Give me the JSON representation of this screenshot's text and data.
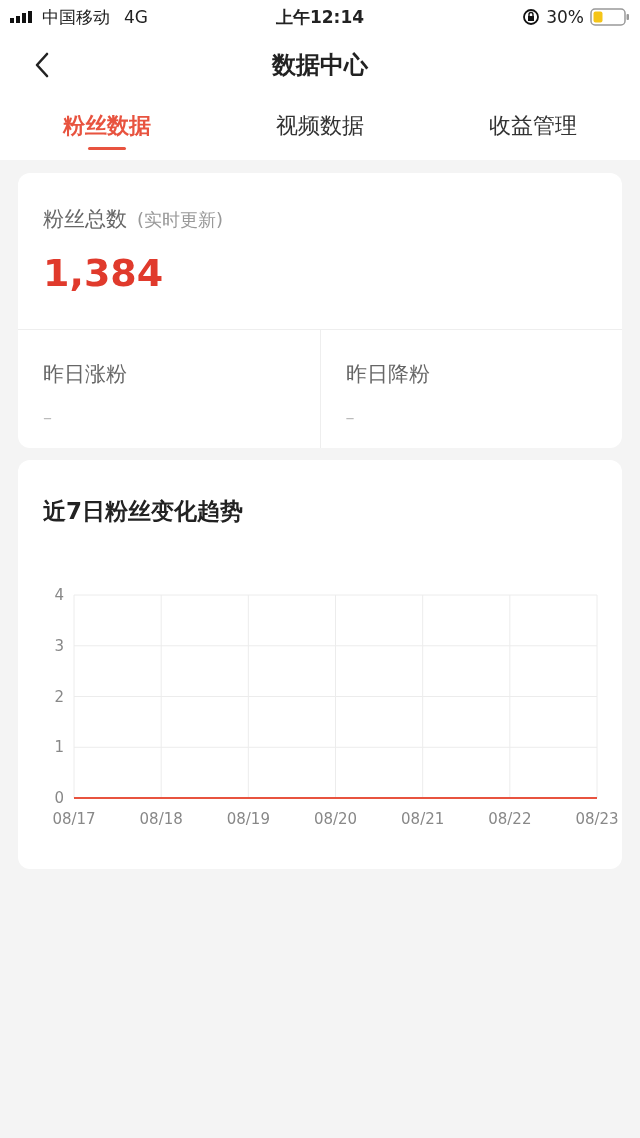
{
  "status_bar": {
    "carrier": "中国移动",
    "network": "4G",
    "time": "上午12:14",
    "battery": "30%"
  },
  "nav": {
    "title": "数据中心"
  },
  "tabs": [
    {
      "label": "粉丝数据",
      "selected": true
    },
    {
      "label": "视频数据",
      "selected": false
    },
    {
      "label": "收益管理",
      "selected": false
    }
  ],
  "summary": {
    "label": "粉丝总数",
    "note": "(实时更新)",
    "value": "1,384",
    "stats": [
      {
        "label": "昨日涨粉",
        "value": "–"
      },
      {
        "label": "昨日降粉",
        "value": "–"
      }
    ]
  },
  "trend": {
    "title": "近7日粉丝变化趋势",
    "chart_data": {
      "type": "line",
      "grid": true,
      "categories": [
        "08/17",
        "08/18",
        "08/19",
        "08/20",
        "08/21",
        "08/22",
        "08/23"
      ],
      "ylim": [
        0,
        4
      ],
      "yticks": [
        0,
        1,
        2,
        3,
        4
      ],
      "series": [
        {
          "color": "#e8533f",
          "values": [
            0,
            0,
            0,
            0,
            0,
            0,
            0
          ]
        }
      ]
    }
  }
}
